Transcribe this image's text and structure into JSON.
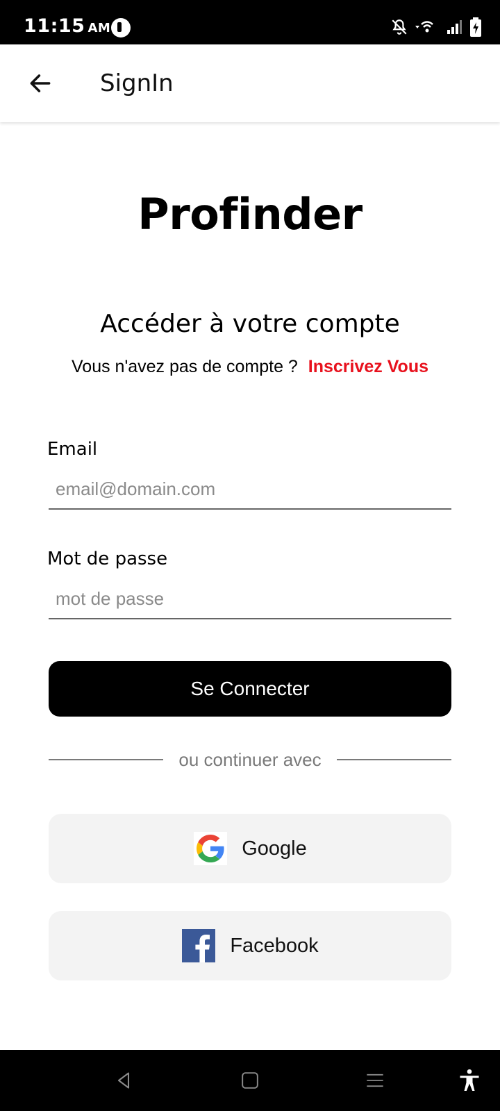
{
  "status_bar": {
    "time": "11:15",
    "ampm": "AM",
    "icons": [
      "app-notification-icon",
      "bell-off-icon",
      "wifi-icon",
      "signal-icon",
      "battery-charging-icon"
    ]
  },
  "app_bar": {
    "title": "SignIn",
    "back_icon": "arrow-left-icon"
  },
  "brand": "Profinder",
  "heading": "Accéder à votre compte",
  "signup": {
    "prompt": "Vous n'avez pas de compte ?",
    "link": "Inscrivez Vous"
  },
  "form": {
    "email_label": "Email",
    "email_value": "",
    "email_placeholder": "email@domain.com",
    "password_label": "Mot de passe",
    "password_value": "",
    "password_placeholder": "mot de passe",
    "submit": "Se Connecter"
  },
  "divider_text": "ou continuer avec",
  "social": {
    "google": "Google",
    "facebook": "Facebook"
  },
  "colors": {
    "accent_link": "#e8111d",
    "primary_button": "#000000",
    "social_button_bg": "#f3f3f3",
    "facebook_blue": "#3b5998"
  },
  "nav_bar": {
    "icons": [
      "back-triangle-icon",
      "home-square-icon",
      "recents-menu-icon",
      "accessibility-icon"
    ]
  }
}
